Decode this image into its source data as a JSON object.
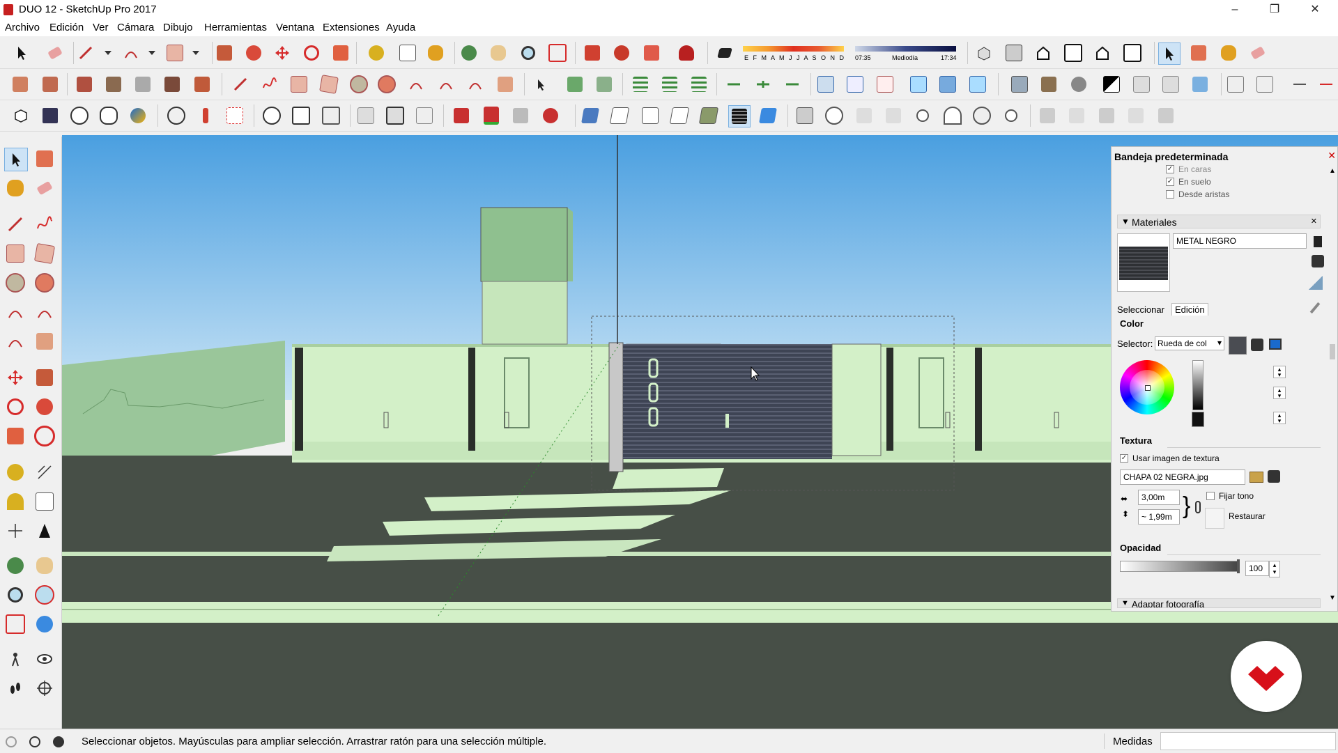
{
  "window": {
    "title": "DUO 12 - SketchUp Pro 2017",
    "minimize": "–",
    "restore": "❐",
    "close": "✕"
  },
  "menu": [
    "Archivo",
    "Edición",
    "Ver",
    "Cámara",
    "Dibujo",
    "Herramientas",
    "Ventana",
    "Extensiones",
    "Ayuda"
  ],
  "shadows": {
    "months": "E F M A M J J A S O N D",
    "time_start": "07:35",
    "time_mid": "Mediodía",
    "time_end": "17:34"
  },
  "tray": {
    "title": "Bandeja predeterminada",
    "close": "✕",
    "shadow_options": [
      {
        "label": "En caras",
        "checked": true
      },
      {
        "label": "En suelo",
        "checked": true
      },
      {
        "label": "Desde aristas",
        "checked": false
      }
    ],
    "materials": {
      "header": "Materiales",
      "name": "METAL NEGRO",
      "tabs": [
        "Seleccionar",
        "Edición"
      ],
      "active_tab": "Edición",
      "color_label": "Color",
      "selector_label": "Selector:",
      "selector_value": "Rueda de col",
      "texture_label": "Textura",
      "use_texture_label": "Usar imagen de textura",
      "use_texture_checked": true,
      "texture_file": "CHAPA 02 NEGRA.jpg",
      "width_value": "3,00m",
      "height_value": "~ 1,99m",
      "fix_hue_label": "Fijar tono",
      "fix_hue_checked": false,
      "reset_label": "Restaurar",
      "opacity_label": "Opacidad",
      "opacity_value": "100",
      "swatch_color": "#3b3d42"
    },
    "next_section": "Adaptar fotografía"
  },
  "scene": {
    "door_letters": [
      "D",
      "U",
      "O"
    ],
    "sky_top": "#4a9fe0",
    "sky_bottom": "#c8e3f5",
    "ground": "#474f47",
    "wall": "#d3f0c8"
  },
  "statusbar": {
    "message": "Seleccionar objetos. Mayúsculas para ampliar selección. Arrastrar ratón para una selección múltiple.",
    "measurements_label": "Medidas",
    "measurements_value": ""
  }
}
